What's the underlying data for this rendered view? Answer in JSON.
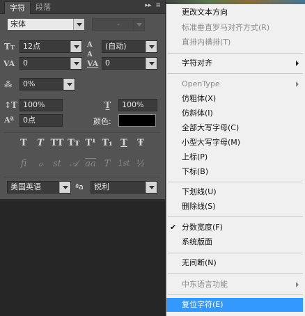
{
  "panel": {
    "tabs": [
      "字符",
      "段落"
    ],
    "controls": [
      "▸▸",
      "≡"
    ],
    "font_family": "宋体",
    "font_style": "-",
    "font_size": "12点",
    "leading": "(自动)",
    "kerning": "0",
    "tracking": "0",
    "scale": "0%",
    "vertical_scale": "100%",
    "horizontal_scale": "100%",
    "baseline_shift": "0点",
    "color_label": "颜色:",
    "color_value": "#000000",
    "language": "美国英语",
    "aa_label": "ªa",
    "antialias": "锐利",
    "style_glyphs": [
      "T",
      "T",
      "TT",
      "Tт",
      "T¹",
      "T₁",
      "T",
      "Ŧ"
    ],
    "opentype_glyphs": [
      "ﬁ",
      "ℴ",
      "st",
      "𝒜",
      "aa",
      "T",
      "1st",
      "½"
    ]
  },
  "menu": {
    "items": [
      {
        "label": "更改文本方向",
        "disabled": false
      },
      {
        "label": "标准垂直罗马对齐方式(R)",
        "disabled": true
      },
      {
        "label": "直排内横排(T)",
        "disabled": true
      },
      {
        "label": "字符对齐",
        "disabled": false,
        "submenu": true
      },
      {
        "label": "OpenType",
        "disabled": true,
        "submenu": true
      },
      {
        "label": "仿粗体(X)",
        "disabled": false
      },
      {
        "label": "仿斜体(I)",
        "disabled": false
      },
      {
        "label": "全部大写字母(C)",
        "disabled": false
      },
      {
        "label": "小型大写字母(M)",
        "disabled": false
      },
      {
        "label": "上标(P)",
        "disabled": false
      },
      {
        "label": "下标(B)",
        "disabled": false
      },
      {
        "label": "下划线(U)",
        "disabled": false
      },
      {
        "label": "删除线(S)",
        "disabled": false
      },
      {
        "label": "分数宽度(F)",
        "disabled": false,
        "checked": true
      },
      {
        "label": "系统版面",
        "disabled": false
      },
      {
        "label": "无间断(N)",
        "disabled": false
      },
      {
        "label": "中东语言功能",
        "disabled": true,
        "submenu": true
      },
      {
        "label": "复位字符(E)",
        "disabled": false,
        "highlighted": true
      }
    ],
    "check_mark": "✔"
  }
}
